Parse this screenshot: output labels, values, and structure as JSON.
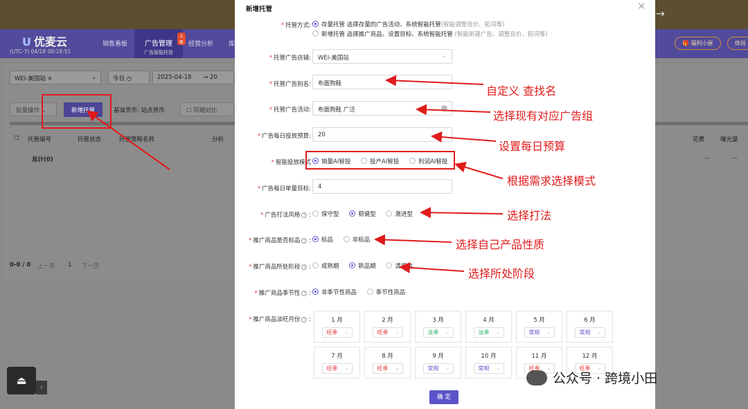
{
  "header": {
    "logo": "优麦云",
    "timezone": "(UTC-7) 04/18 00:18:51",
    "nav": [
      "销售看板",
      "广告管理",
      "经营分析",
      "库"
    ],
    "nav_active_sub": "广告智能托管",
    "new_badge": "上新",
    "right_pills": [
      "福利小屋",
      "体验"
    ]
  },
  "toolbar": {
    "shop": "WEI-美国站",
    "date_preset": "今日",
    "start_date": "2025-04-18",
    "date_sep": "→",
    "end_date_partial": "20",
    "batch_ops": "批量操作",
    "new_hosting": "新增托管",
    "base_currency": "基准货币: 站点货币",
    "compare": "同期对比"
  },
  "table": {
    "columns": [
      "托管编号",
      "托管状态",
      "托管策略名称",
      "分析"
    ],
    "right_columns": [
      "花费",
      "曝光量"
    ],
    "total_row": "总计(0)",
    "dashes": "--",
    "pagination": {
      "range": "0-0 / 0",
      "prev": "上一页",
      "page": "1",
      "next": "下一页"
    }
  },
  "modal": {
    "title": "新增托管",
    "hosting_mode": {
      "label": "托管方式:",
      "opt1": "存量托管",
      "opt1_desc": "选择存量的广告活动、系统智能托管",
      "opt1_hint": "(智能调整竞价、拓词等)",
      "opt2": "新增托管",
      "opt2_desc": "选择推广商品、设置目标、系统智能托管",
      "opt2_hint": "(智能新建广告、调整竞价、拓词等)"
    },
    "shop": {
      "label": "托管广告店铺:",
      "value": "WEI-美国站"
    },
    "alias": {
      "label": "托管广告别名:",
      "value": "布面狗鞋"
    },
    "campaign": {
      "label": "托管广告活动:",
      "value": "布面狗鞋  广泛"
    },
    "daily_budget": {
      "label": "广告每日投放预算:",
      "value": "20"
    },
    "smart_mode": {
      "label": "智能投放模式",
      "options": [
        "销量AI智投",
        "投产AI智投",
        "利润AI智投"
      ],
      "selected": 0
    },
    "daily_target": {
      "label": "广告每日单量目标:",
      "value": "4"
    },
    "style": {
      "label": "广告打法风格",
      "options": [
        "保守型",
        "稳健型",
        "激进型"
      ],
      "selected": 1
    },
    "is_standard": {
      "label": "推广商品是否标品",
      "options": [
        "标品",
        "非标品"
      ],
      "selected": 0
    },
    "stage": {
      "label": "推广商品所处阶段",
      "options": [
        "成熟期",
        "新品期",
        "清库存"
      ],
      "selected": 1
    },
    "seasonal": {
      "label": "推广商品季节性",
      "options": [
        "非季节性商品",
        "季节性商品"
      ],
      "selected": 0
    },
    "months": {
      "label": "推广商品淡旺月份",
      "items": [
        {
          "name": "1 月",
          "value": "旺季",
          "color": "#e23b3b"
        },
        {
          "name": "2 月",
          "value": "旺季",
          "color": "#e23b3b"
        },
        {
          "name": "3 月",
          "value": "淡季",
          "color": "#2bae66"
        },
        {
          "name": "4 月",
          "value": "淡季",
          "color": "#2bae66"
        },
        {
          "name": "5 月",
          "value": "常规",
          "color": "#5b54c9"
        },
        {
          "name": "6 月",
          "value": "常规",
          "color": "#5b54c9"
        },
        {
          "name": "7 月",
          "value": "旺季",
          "color": "#e23b3b"
        },
        {
          "name": "8 月",
          "value": "旺季",
          "color": "#e23b3b"
        },
        {
          "name": "9 月",
          "value": "常规",
          "color": "#5b54c9"
        },
        {
          "name": "10 月",
          "value": "常规",
          "color": "#5b54c9"
        },
        {
          "name": "11 月",
          "value": "旺季",
          "color": "#e23b3b"
        },
        {
          "name": "12 月",
          "value": "旺季",
          "color": "#e23b3b"
        }
      ]
    },
    "confirm": "确 定"
  },
  "annotations": [
    "自定义 查找名",
    "选择现有对应广告组",
    "设置每日预算",
    "根据需求选择模式",
    "选择打法",
    "选择自己产品性质",
    "选择所处阶段"
  ],
  "watermark": "公众号 · 跨境小田",
  "colors": {
    "accent": "#5b54c9",
    "annotation": "#e01b1b",
    "header": "#524a9a"
  }
}
